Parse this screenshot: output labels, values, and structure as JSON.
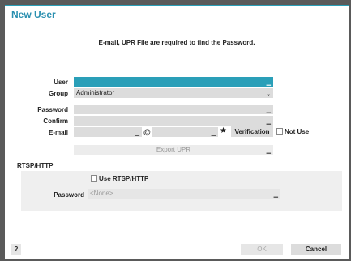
{
  "dialog": {
    "title": "New User",
    "notice": "E-mail, UPR File are required to find the Password."
  },
  "form": {
    "user_label": "User",
    "user_value": "",
    "group_label": "Group",
    "group_value": "Administrator",
    "password_label": "Password",
    "confirm_label": "Confirm",
    "email_label": "E-mail",
    "email_at": "@",
    "email_star": "★",
    "verification_label": "Verification",
    "not_use_label": "Not Use",
    "export_upr_label": "Export UPR"
  },
  "rtsp": {
    "section_title": "RTSP/HTTP",
    "use_label": "Use RTSP/HTTP",
    "password_label": "Password",
    "password_value": "<None>"
  },
  "footer": {
    "help_label": "?",
    "ok_label": "OK",
    "cancel_label": "Cancel"
  },
  "colors": {
    "accent": "#2a9fb8",
    "title": "#2a8fb0"
  }
}
